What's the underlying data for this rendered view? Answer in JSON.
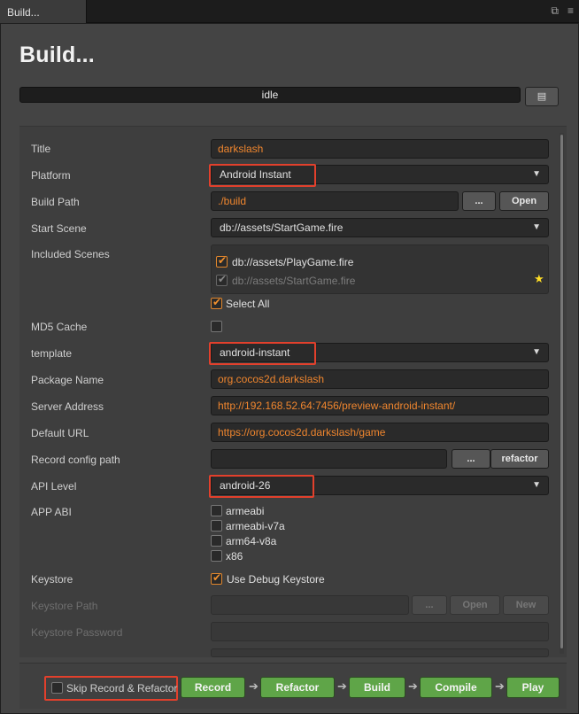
{
  "tab": {
    "title": "Build..."
  },
  "header": {
    "title": "Build...",
    "progress_text": "idle"
  },
  "fields": {
    "title": {
      "label": "Title",
      "value": "darkslash"
    },
    "platform": {
      "label": "Platform",
      "value": "Android Instant"
    },
    "build_path": {
      "label": "Build Path",
      "value": "./build",
      "browse": "...",
      "open": "Open"
    },
    "start_scene": {
      "label": "Start Scene",
      "value": "db://assets/StartGame.fire"
    },
    "included_scenes": {
      "label": "Included Scenes",
      "items": [
        "db://assets/PlayGame.fire",
        "db://assets/StartGame.fire"
      ],
      "select_all": "Select All"
    },
    "md5": {
      "label": "MD5 Cache"
    },
    "template": {
      "label": "template",
      "value": "android-instant"
    },
    "package_name": {
      "label": "Package Name",
      "value": "org.cocos2d.darkslash"
    },
    "server_address": {
      "label": "Server Address",
      "value": "http://192.168.52.64:7456/preview-android-instant/"
    },
    "default_url": {
      "label": "Default URL",
      "value": "https://org.cocos2d.darkslash/game"
    },
    "record_config": {
      "label": "Record config path",
      "value": "",
      "browse": "...",
      "refactor": "refactor"
    },
    "api_level": {
      "label": "API Level",
      "value": "android-26"
    },
    "app_abi": {
      "label": "APP ABI",
      "options": [
        "armeabi",
        "armeabi-v7a",
        "arm64-v8a",
        "x86"
      ]
    },
    "keystore": {
      "label": "Keystore",
      "use_debug": "Use Debug Keystore"
    },
    "keystore_path": {
      "label": "Keystore Path",
      "browse": "...",
      "open": "Open",
      "new": "New"
    },
    "keystore_password": {
      "label": "Keystore Password"
    }
  },
  "footer": {
    "skip_label": "Skip Record & Refactor",
    "buttons": [
      "Record",
      "Refactor",
      "Build",
      "Compile",
      "Play"
    ]
  },
  "colors": {
    "accent_orange": "#f0862e",
    "highlight_red": "#e2402c",
    "button_green": "#5fa548"
  },
  "icons": {
    "restore": "restore-icon",
    "menu": "menu-icon",
    "file": "file-icon",
    "star": "star-icon"
  }
}
